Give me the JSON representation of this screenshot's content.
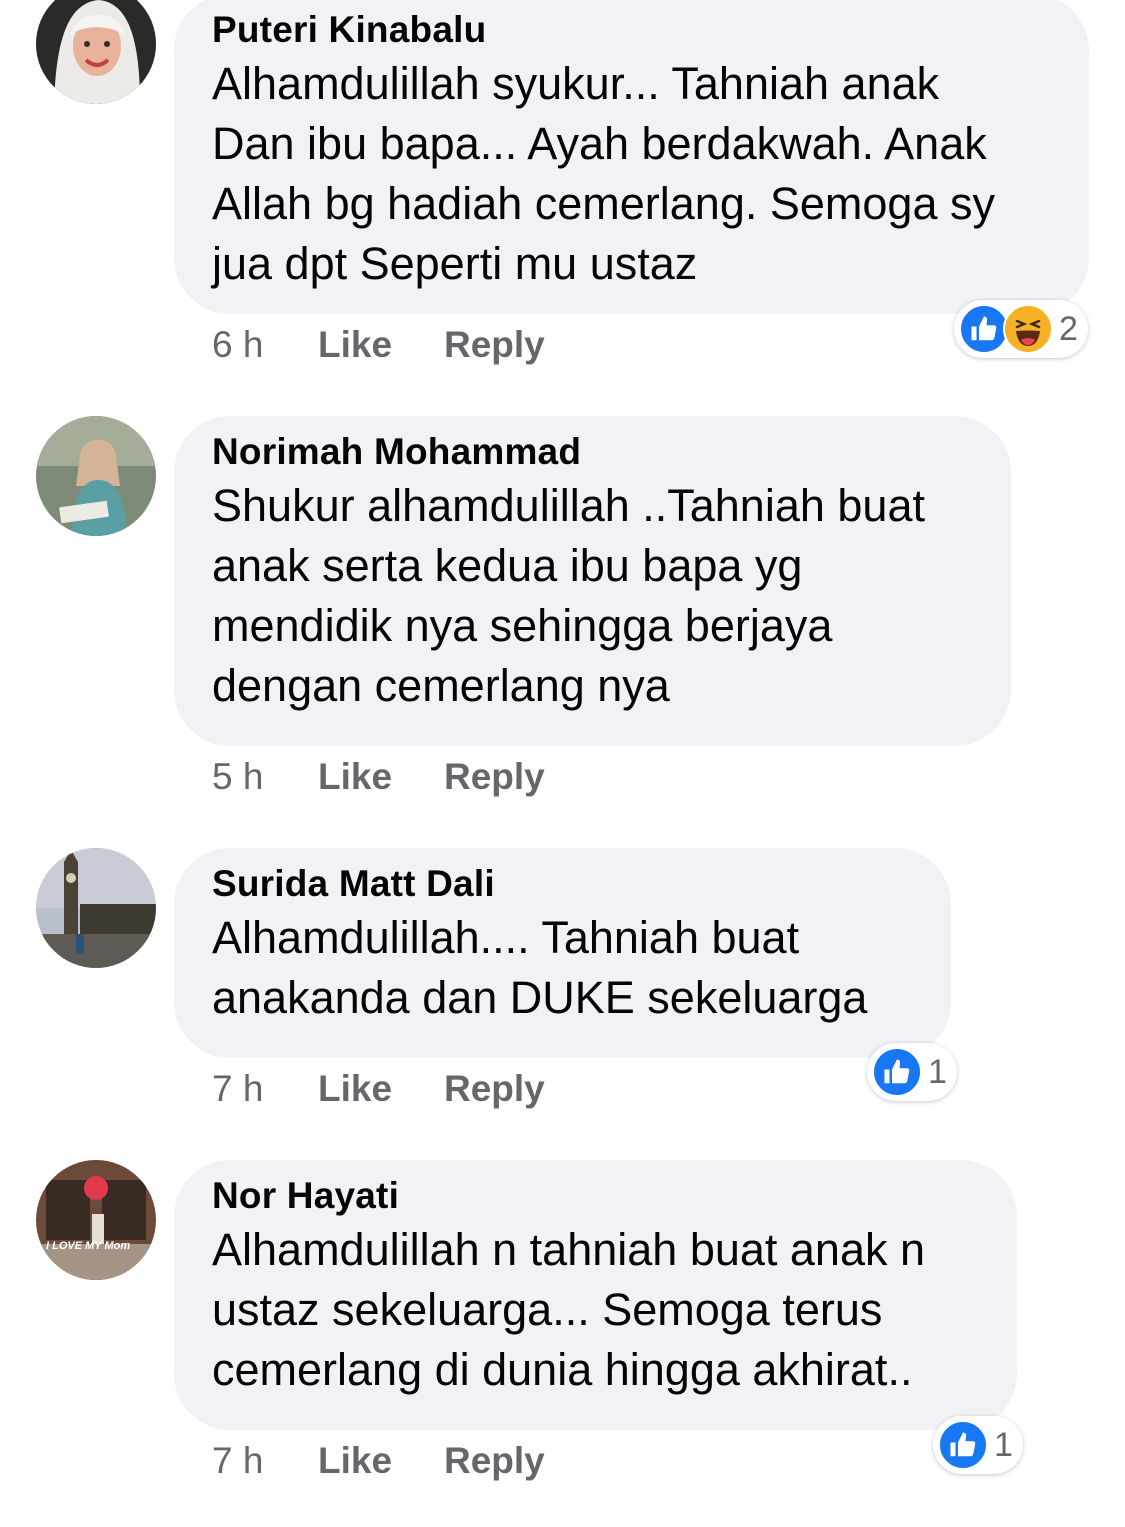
{
  "comments": [
    {
      "author": "Puteri Kinabalu",
      "text": "Alhamdulillah syukur... Tahniah anak\nDan ibu bapa... Ayah berdakwah. Anak\nAllah bg hadiah cemerlang. Semoga sy\njua dpt Seperti mu ustaz",
      "time": "6 h",
      "like_label": "Like",
      "reply_label": "Reply",
      "reactions": {
        "icons": [
          "like-reaction",
          "haha-reaction"
        ],
        "count": "2"
      }
    },
    {
      "author": "Norimah Mohammad",
      "text": "Shukur alhamdulillah ..Tahniah buat\nanak serta kedua ibu bapa yg\nmendidik nya sehingga berjaya\ndengan cemerlang nya",
      "time": "5 h",
      "like_label": "Like",
      "reply_label": "Reply"
    },
    {
      "author": "Surida Matt Dali",
      "text": "Alhamdulillah.... Tahniah buat\nanakanda dan  DUKE sekeluarga",
      "time": "7 h",
      "like_label": "Like",
      "reply_label": "Reply",
      "reactions": {
        "icons": [
          "like-reaction"
        ],
        "count": "1"
      }
    },
    {
      "author": "Nor Hayati",
      "text": "Alhamdulillah n tahniah buat anak n\nustaz sekeluarga... Semoga terus\ncemerlang di dunia hingga akhirat..",
      "time": "7 h",
      "like_label": "Like",
      "reply_label": "Reply",
      "avatar_caption": "I LOVE MY Mom",
      "reactions": {
        "icons": [
          "like-reaction"
        ],
        "count": "1"
      }
    }
  ],
  "colors": {
    "bubble": "#f0f2f5",
    "secondary_text": "#65676b",
    "like_blue": "#1877f2",
    "haha_yellow": "#f7b125"
  }
}
